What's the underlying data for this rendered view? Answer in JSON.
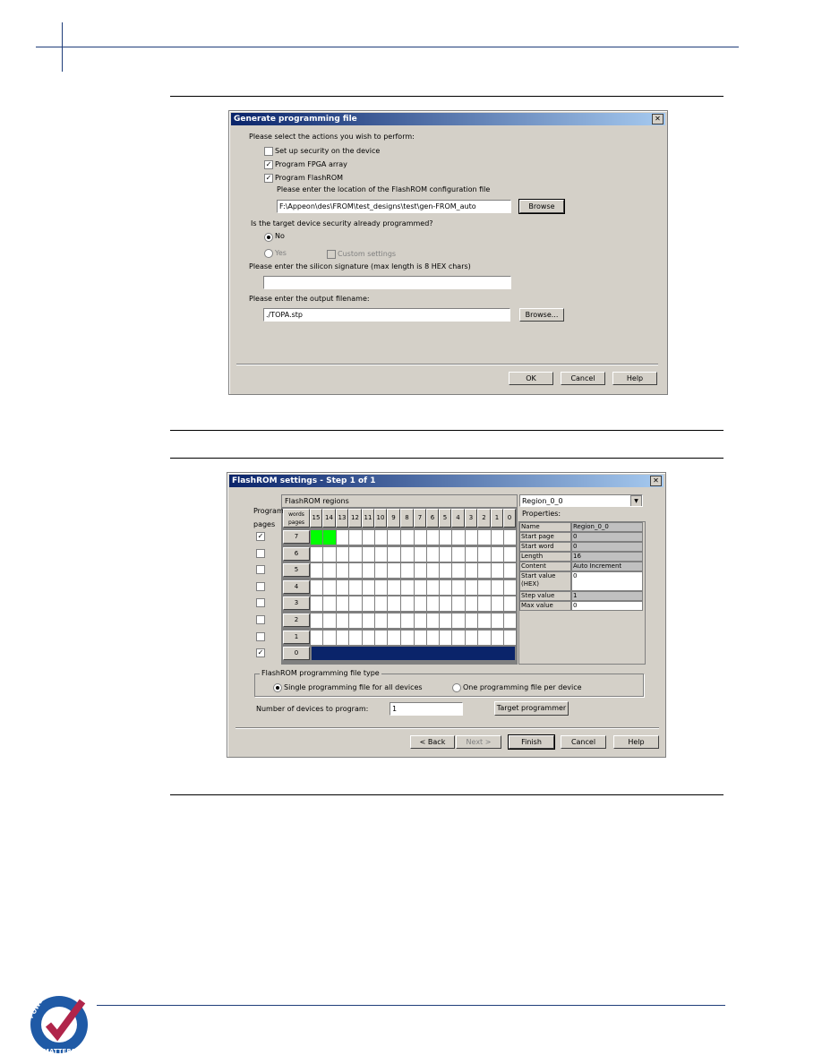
{
  "colors": {
    "header_blue": "#1f3d7a",
    "cell_green": "#00ff00",
    "fill_navy": "#0a246a",
    "dialog_bg": "#d4d0c8"
  },
  "logo": {
    "text": "POWER MATTERS",
    "icon": "checkmark-badge-icon"
  },
  "dialog1": {
    "title": "Generate programming file",
    "prompt": "Please select the actions you wish to perform:",
    "options": [
      {
        "label": "Set up security on the device",
        "checked": false
      },
      {
        "label": "Program FPGA array",
        "checked": true
      },
      {
        "label": "Program FlashROM",
        "checked": true
      }
    ],
    "flashrom_location_label": "Please enter the location of the FlashROM configuration file",
    "flashrom_path": "F:\\Appeon\\des\\FROM\\test_designs\\test\\gen-FROM_auto",
    "browse": "Browse",
    "security_question": "Is the target device security already programmed?",
    "no": "No",
    "yes": "Yes",
    "selected": "No",
    "custom_settings": "Custom settings",
    "signature_label": "Please enter the silicon signature (max length is 8 HEX chars)",
    "signature_value": "",
    "output_label": "Please enter the output filename:",
    "output_value": "./TOPA.stp",
    "browse2": "Browse...",
    "ok": "OK",
    "cancel": "Cancel",
    "help": "Help"
  },
  "dialog2": {
    "title": "FlashROM settings - Step 1 of 1",
    "regions_label": "FlashROM regions",
    "program_pages_label": [
      "Program",
      "pages"
    ],
    "corner_header": [
      "words",
      "pages"
    ],
    "words": [
      "15",
      "14",
      "13",
      "12",
      "11",
      "10",
      "9",
      "8",
      "7",
      "6",
      "5",
      "4",
      "3",
      "2",
      "1",
      "0"
    ],
    "pages": [
      {
        "label": "7",
        "checked": true
      },
      {
        "label": "6",
        "checked": false
      },
      {
        "label": "5",
        "checked": false
      },
      {
        "label": "4",
        "checked": false
      },
      {
        "label": "3",
        "checked": false
      },
      {
        "label": "2",
        "checked": false
      },
      {
        "label": "1",
        "checked": false
      },
      {
        "label": "0",
        "checked": true
      }
    ],
    "page7_green_words": [
      "15",
      "14"
    ],
    "page0_filled": true,
    "region_select": "Region_0_0",
    "properties_label": "Properties:",
    "properties": [
      [
        "Name",
        "Region_0_0"
      ],
      [
        "Start page",
        "0"
      ],
      [
        "Start word",
        "0"
      ],
      [
        "Length",
        "16"
      ],
      [
        "Content",
        "Auto Increment"
      ],
      [
        "Start value (HEX)",
        "0"
      ],
      [
        "Step value (HEX)",
        "1"
      ],
      [
        "Max value (HEX)",
        "0"
      ]
    ],
    "filetype_label": "FlashROM programming file type",
    "single_file": "Single programming file for all devices",
    "per_device": "One programming file per device",
    "devices_label": "Number of devices to program:",
    "devices_value": "1",
    "target_programmer": "Target programmer",
    "back": "< Back",
    "next": "Next >",
    "finish": "Finish",
    "cancel": "Cancel",
    "help": "Help"
  }
}
